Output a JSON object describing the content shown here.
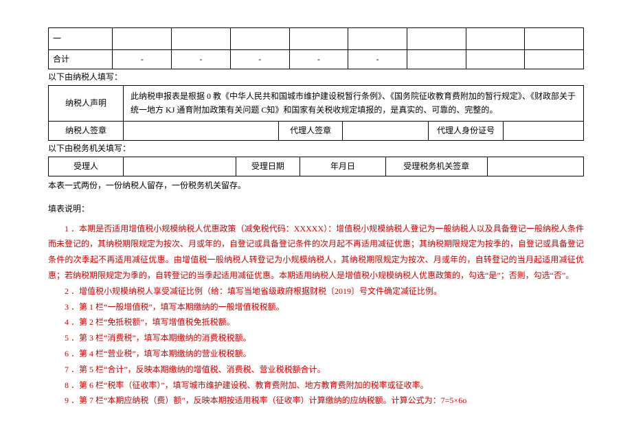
{
  "tableTop": {
    "dashCell": "一",
    "total": "合计",
    "c1": "-",
    "c2": "-",
    "c3": "-",
    "c4": "-",
    "c5": "-"
  },
  "taxpayerSection": {
    "header": "以下由纳税人填写：",
    "declLabel": "纳税人声明",
    "declText": "此纳税申报表是根据 0 教《中华人民共和国城市维护建设税暂行条例》、《国务院征收教育费附加的暂行规定》、《财政部关于统一地方 KJ 通育附加政策有关问题 C知》和国家有关税收规定填报的，是真实的、可靠的、完整的。",
    "sigLabel": "纳税人签章",
    "agentSigLabel": "代理人签章",
    "agentIdLabel": "代理人身份证号"
  },
  "authoritySection": {
    "header": "以下由税务机关填写：",
    "recvLabel": "受理人",
    "recvDateLabel": "受理日期",
    "dateText": "年月日",
    "authSigLabel": "受理税务机关签章"
  },
  "note": "本表一式两份，一份纳税人留存，一份税务机关留存。",
  "instructionsTitle": "填表说明：",
  "instructions": {
    "i1": "1 ．本期是否适用增值税小规模纳税人优惠政策（减免税代码：XXXXX）：增值税小规模纳税人登记为一般纳税人以及具备登记一般纳税人条件而未登记的，其纳税期限规定为按次、月或年的，自登记或具备登记条件的次月起不再适用减征优惠；其纳税期限规定为按季的，自登记或具备登记条件的次季起不再适用减征优惠。由增值税一般纳税人转登记为小规模纳税人，其纳税期限规定为按次、月或年的，自转登记的当月起适用减征优惠；若纳税期限规定为季的，自转登记的当季起适用减征优惠。本期适用纳税人是增值税小规模纳税人优惠政策的，勾选“是”；否则，勾选“否”。",
    "i2": "2 ．增值税小规模纳税人享受减征比例（给：填写当地省级政府根据财税〔2019〕号文件确定减征比例。",
    "i3": "3 ．第 1 栏“一般增值税”，填写本期缴纳的一般增值税税额。",
    "i4": "4 ．第 2 栏“免抵税额”，填写增值税免抵税额。",
    "i5": "5 ．第 3 栏“消费税”，填写本期缴纳的消费税税额。",
    "i6": "6 ．第 4 栏“营业税”，填写本期缴纳的营业税税额。",
    "i7": "7 ．第 5 栏“合计”，反映本期缴纳的增值税、消费税、营业税税额合计。",
    "i8": "8 ．第 6 栏“税率（征收率）”，填写城市维护建设税、教育费附加、地方教育费附加的税率或征收率。",
    "i9": "9 ．第 7 栏“本期应纳税（费）额”，反映本期按适用税率（征收率）计算缴纳的应纳税额。计算公式为：7=5×6o"
  }
}
